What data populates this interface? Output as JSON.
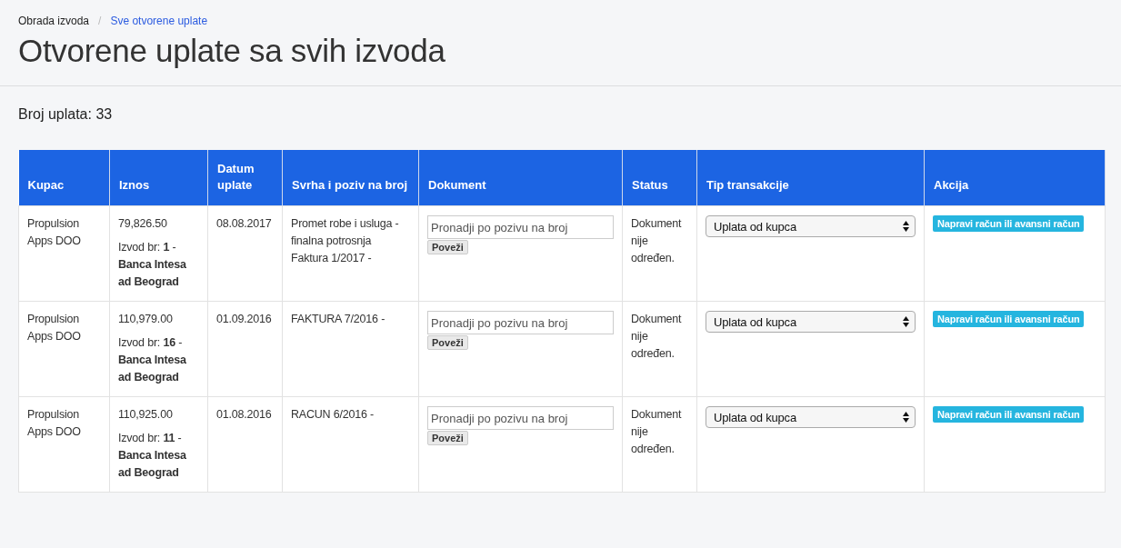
{
  "breadcrumb_separator": "/",
  "breadcrumb": [
    {
      "label": "Obrada izvoda",
      "selected": false
    },
    {
      "label": "Sve otvorene uplate",
      "selected": true
    }
  ],
  "title": "Otvorene uplate sa svih izvoda",
  "count_label": "Broj uplata: 33",
  "table": {
    "columns": [
      "Kupac",
      "Iznos",
      "Datum uplate",
      "Svrha i poziv na broj",
      "Dokument",
      "Status",
      "Tip transakcije",
      "Akcija"
    ],
    "rows": [
      {
        "customer": "Propulsion Apps DOO",
        "amount": "79,826.50",
        "statement": "Izvod br: **1** - **Banca Intesa ad Beograd**",
        "date": "08.08.2017",
        "purpose": "Promet robe i usluga - finalna potrosnja Faktura 1/2017 -",
        "document_placeholder": "Pronadji po pozivu na broj",
        "link_button": "Poveži",
        "status": "Dokument nije određen.",
        "transaction_type": "Uplata od kupca",
        "action": "Napravi račun ili avansni račun"
      },
      {
        "customer": "Propulsion Apps DOO",
        "amount": "110,979.00",
        "statement": "Izvod br: **16** - **Banca Intesa ad Beograd**",
        "date": "01.09.2016",
        "purpose": "FAKTURA 7/2016 -",
        "document_placeholder": "Pronadji po pozivu na broj",
        "link_button": "Poveži",
        "status": "Dokument nije određen.",
        "transaction_type": "Uplata od kupca",
        "action": "Napravi račun ili avansni račun"
      },
      {
        "customer": "Propulsion Apps DOO",
        "amount": "110,925.00",
        "statement": "Izvod br: **11** - **Banca Intesa ad Beograd**",
        "date": "01.08.2016",
        "purpose": "RACUN 6/2016 -",
        "document_placeholder": "Pronadji po pozivu na broj",
        "link_button": "Poveži",
        "status": "Dokument nije određen.",
        "transaction_type": "Uplata od kupca",
        "action": "Napravi račun ili avansni račun"
      }
    ]
  }
}
